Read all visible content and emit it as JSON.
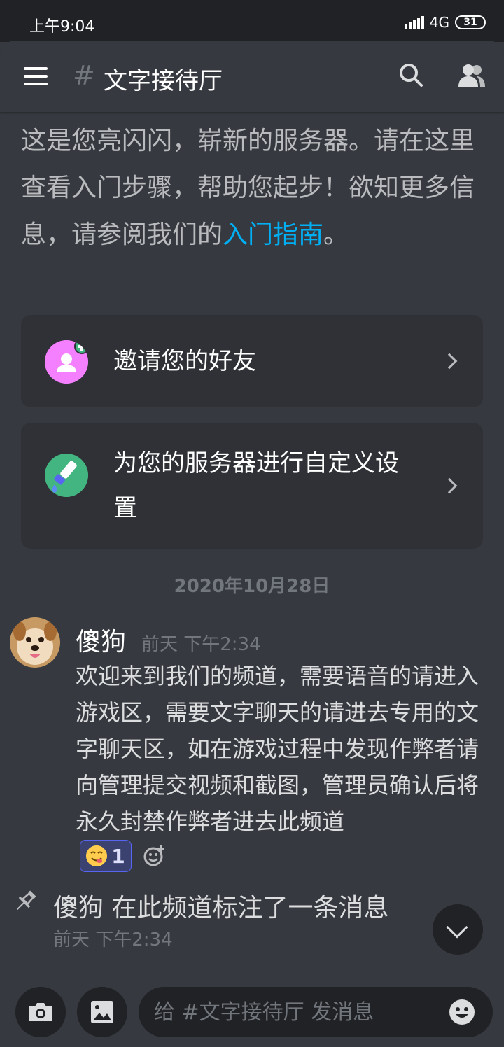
{
  "status_bar": {
    "time": "上午9:04",
    "network": "4G",
    "battery": "31"
  },
  "header": {
    "hash": "#",
    "channel_name": "文字接待厅"
  },
  "intro": {
    "text": "这是您亮闪闪，崭新的服务器。请在这里查看入门步骤，帮助您起步！欲知更多信息，请参阅我们的",
    "link": "入门指南",
    "end": "。"
  },
  "cards": {
    "invite_label": "邀请您的好友",
    "customize_label": "为您的服务器进行自定义设置"
  },
  "divider_date": "2020年10月28日",
  "message": {
    "author": "傻狗",
    "timestamp": "前天 下午2:34",
    "text": "欢迎来到我们的频道，需要语音的请进入游戏区，需要文字聊天的请进去专用的文字聊天区，如在游戏过程中发现作弊者请向管理提交视频和截图，管理员确认后将永久封禁作弊者进去此频道",
    "reaction_count": "1"
  },
  "pin_notice": {
    "text": "傻狗 在此频道标注了一条消息",
    "timestamp": "前天 下午2:34"
  },
  "composer": {
    "placeholder": "给 #文字接待厅 发消息"
  },
  "colors": {
    "background": "#36393f",
    "link": "#00aff4",
    "invite_icon": "#f47fff",
    "customize_icon": "#43b581",
    "reaction_border": "#5865f2"
  }
}
